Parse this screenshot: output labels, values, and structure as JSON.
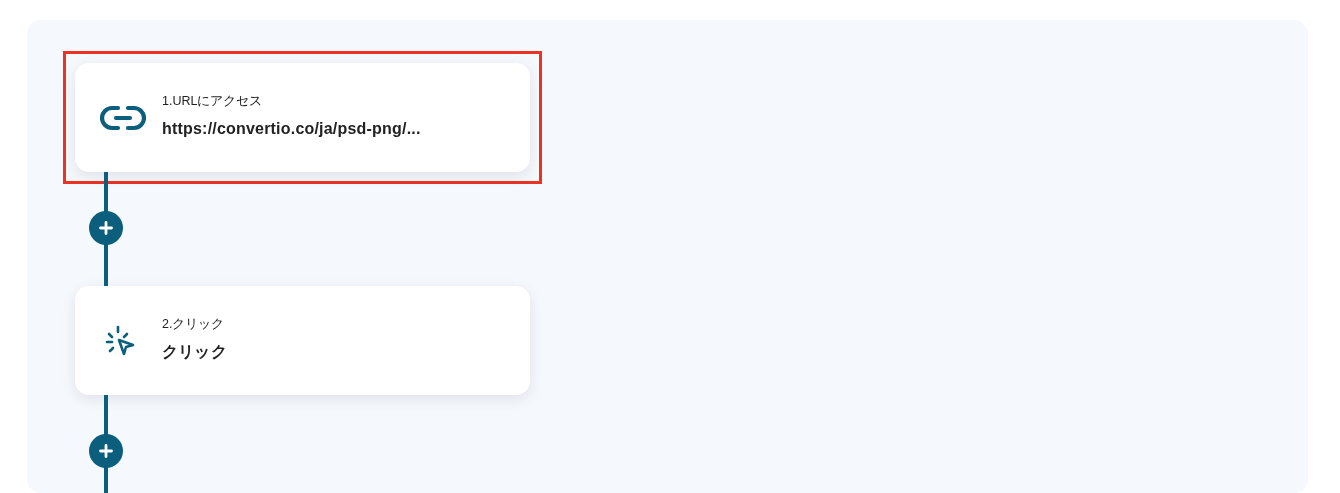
{
  "steps": [
    {
      "kind": "link",
      "label": "1.URLにアクセス",
      "value": "https://convertio.co/ja/psd-png/...",
      "highlighted": true
    },
    {
      "kind": "click",
      "label": "2.クリック",
      "value": "クリック",
      "highlighted": false
    }
  ]
}
